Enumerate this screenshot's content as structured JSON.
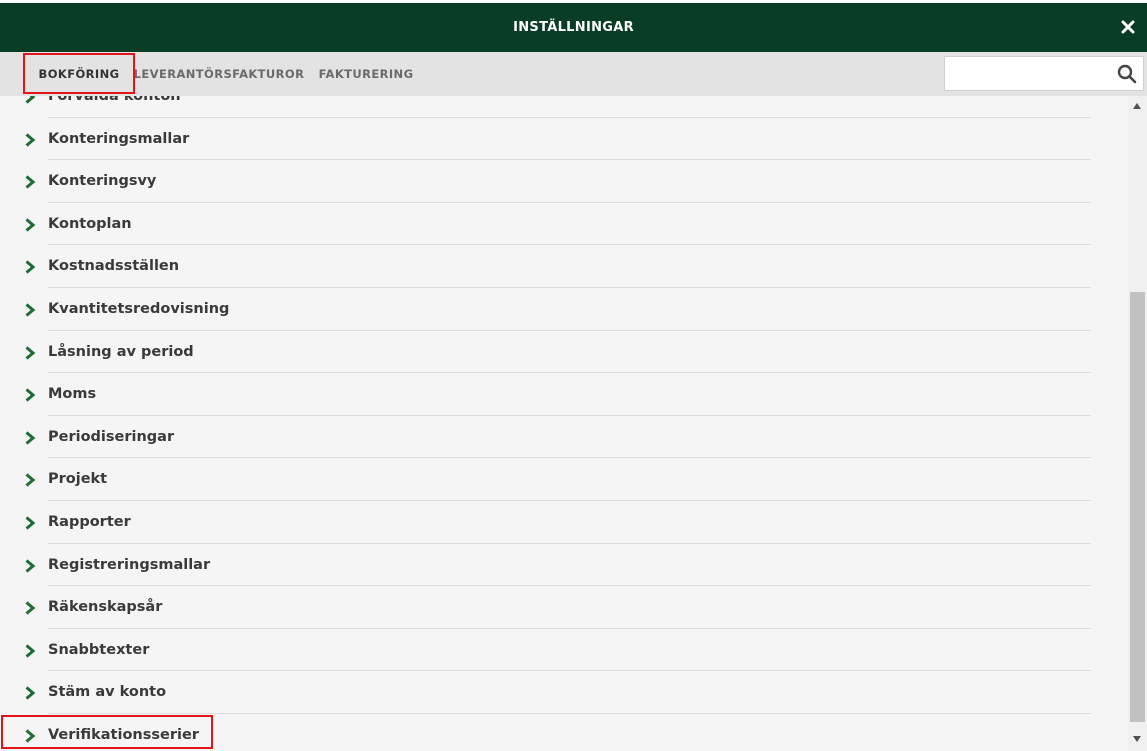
{
  "header": {
    "title": "INSTÄLLNINGAR",
    "close_icon": "close-icon"
  },
  "tabs": [
    {
      "label": "BOKFÖRING",
      "active": true
    },
    {
      "label": "LEVERANTÖRSFAKTUROR",
      "active": false
    },
    {
      "label": "FAKTURERING",
      "active": false
    }
  ],
  "search": {
    "value": "",
    "placeholder": "",
    "icon": "search-icon"
  },
  "colors": {
    "header_bg": "#0a3d25",
    "chevron": "#1e6b35",
    "highlight": "#e4141b"
  },
  "list": {
    "items": [
      "Förvalda konton",
      "Konteringsmallar",
      "Konteringsvy",
      "Kontoplan",
      "Kostnadsställen",
      "Kvantitetsredovisning",
      "Låsning av period",
      "Moms",
      "Periodiseringar",
      "Projekt",
      "Rapporter",
      "Registreringsmallar",
      "Räkenskapsår",
      "Snabbtexter",
      "Stäm av konto",
      "Verifikationsserier"
    ]
  }
}
